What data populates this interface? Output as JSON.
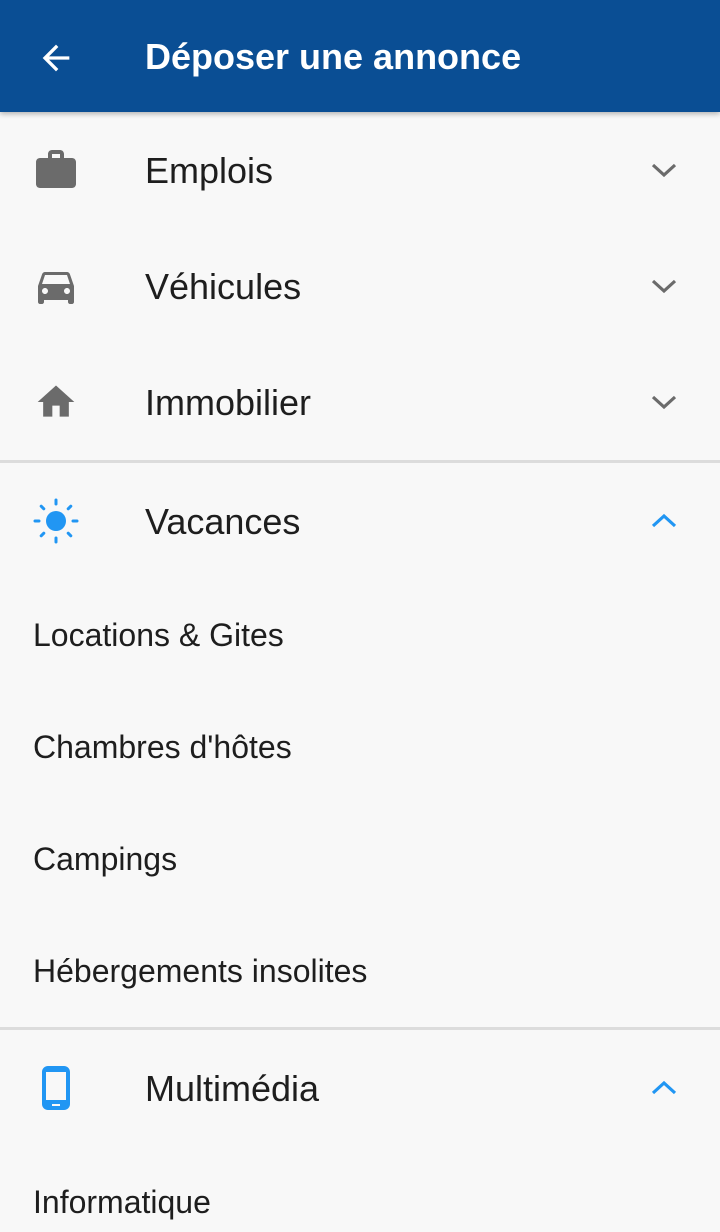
{
  "app_bar": {
    "title": "Déposer une annonce",
    "back_icon": "arrow-left-icon",
    "background_color": "#0a4e94"
  },
  "colors": {
    "accent": "#2196f3",
    "icon_gray": "#6b6b6b",
    "text": "#1e1e1e",
    "divider": "#dcdcdc"
  },
  "categories": [
    {
      "label": "Emplois",
      "icon": "briefcase-icon",
      "expanded": false
    },
    {
      "label": "Véhicules",
      "icon": "car-icon",
      "expanded": false
    },
    {
      "label": "Immobilier",
      "icon": "home-icon",
      "expanded": false
    },
    {
      "label": "Vacances",
      "icon": "sun-icon",
      "expanded": true,
      "subcategories": [
        "Locations & Gites",
        "Chambres d'hôtes",
        "Campings",
        "Hébergements insolites"
      ]
    },
    {
      "label": "Multimédia",
      "icon": "smartphone-icon",
      "expanded": true,
      "subcategories": [
        "Informatique"
      ]
    }
  ]
}
